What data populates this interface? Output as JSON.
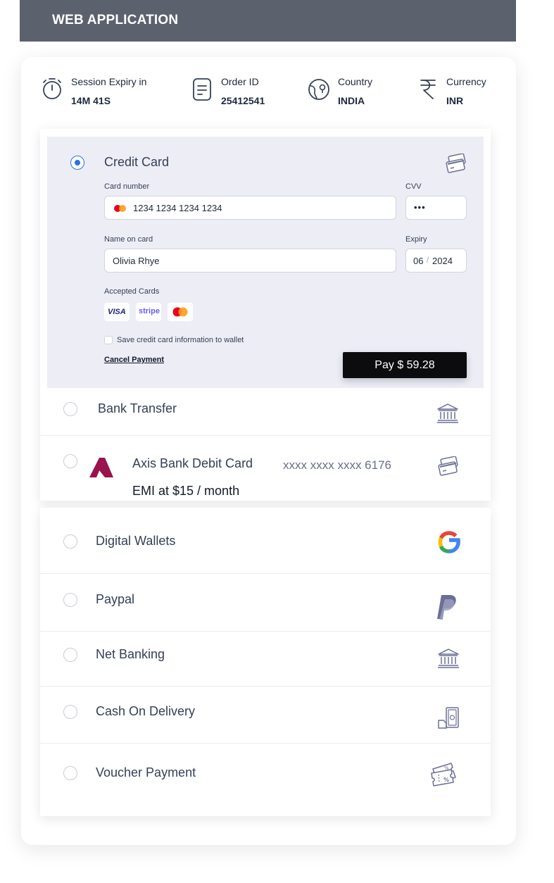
{
  "header": {
    "title": "WEB APPLICATION"
  },
  "info": {
    "session": {
      "label": "Session Expiry in",
      "value": "14M 41S",
      "icon": "timer-icon"
    },
    "order": {
      "label": "Order ID",
      "value": "25412541",
      "icon": "document-icon"
    },
    "country": {
      "label": "Country",
      "value": "INDIA",
      "icon": "globe-icon"
    },
    "currency": {
      "label": "Currency",
      "value": "INR",
      "icon": "rupee-icon"
    }
  },
  "credit_card": {
    "title": "Credit Card",
    "card_number_label": "Card number",
    "card_number_value": "1234 1234 1234 1234",
    "cvv_label": "CVV",
    "cvv_value": "•••",
    "name_label": "Name on card",
    "name_value": "Olivia Rhye",
    "expiry_label": "Expiry",
    "expiry_month": "06",
    "expiry_sep": "/",
    "expiry_year": "2024",
    "accepted_label": "Accepted Cards",
    "visa": "VISA",
    "stripe": "stripe",
    "save_label": "Save credit card information to wallet",
    "cancel_label": "Cancel Payment",
    "pay_label": "Pay $ 59.28"
  },
  "methods": {
    "bank_transfer": "Bank Transfer",
    "axis_name": "Axis Bank Debit Card",
    "axis_number": "xxxx xxxx xxxx 6176",
    "axis_emi": "EMI at $15 / month",
    "digital_wallets": "Digital Wallets",
    "paypal": "Paypal",
    "net_banking": "Net Banking",
    "cod": "Cash On Delivery",
    "voucher": "Voucher Payment"
  },
  "colors": {
    "header_bg": "#5b616d",
    "selected_bg": "#ededf6",
    "radio_selected": "#2f6fe6",
    "pay_button": "#0c0c0e",
    "axis_brand": "#97144d",
    "icon_stroke": "#6b6f96"
  }
}
